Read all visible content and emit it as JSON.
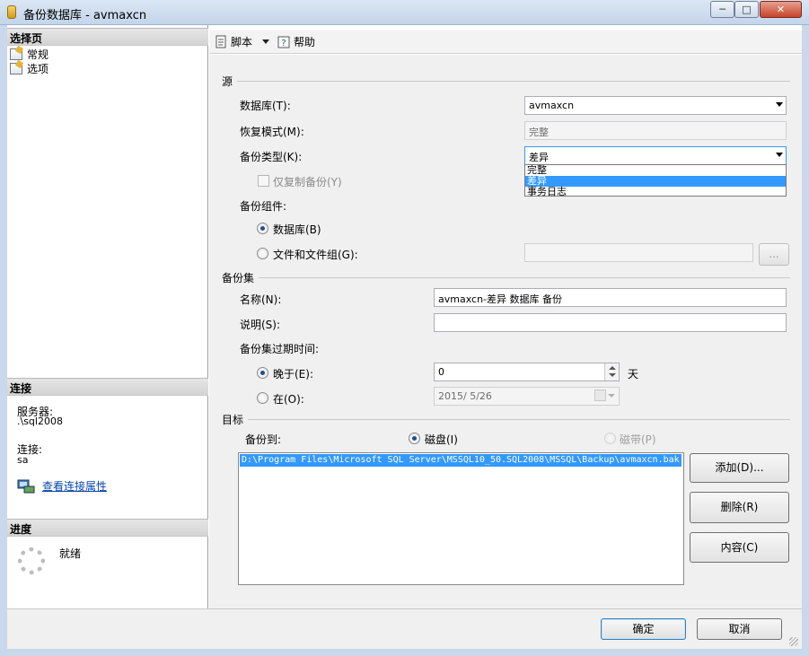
{
  "window": {
    "title": "备份数据库 - avmaxcn",
    "controls": {
      "minimize": "─",
      "maximize": "□",
      "close": "✕"
    }
  },
  "left_panel": {
    "select_page_header": "选择页",
    "pages": [
      {
        "label": "常规",
        "icon": "page-icon"
      },
      {
        "label": "选项",
        "icon": "page-icon"
      }
    ],
    "connection_header": "连接",
    "server_label": "服务器:",
    "server_value": ".\\sql2008",
    "connection_label": "连接:",
    "connection_value": "sa",
    "view_props_link": "查看连接属性",
    "progress_header": "进度",
    "progress_status": "就绪"
  },
  "toolbar": {
    "script_label": "脚本",
    "help_label": "帮助"
  },
  "source": {
    "group_label": "源",
    "database_label": "数据库(T):",
    "database_value": "avmaxcn",
    "recovery_label": "恢复模式(M):",
    "recovery_value": "完整",
    "backup_type_label": "备份类型(K):",
    "backup_type_value": "差异",
    "backup_type_options": [
      "完整",
      "差异",
      "事务日志"
    ],
    "selected_option": "差异",
    "copy_only_label": "仅复制备份(Y)",
    "component_label": "备份组件:",
    "component_database_label": "数据库(B)",
    "component_files_label": "文件和文件组(G):",
    "browse_label": "..."
  },
  "backup_set": {
    "group_label": "备份集",
    "name_label": "名称(N):",
    "name_value": "avmaxcn-差异 数据库 备份",
    "desc_label": "说明(S):",
    "desc_value": "",
    "expire_label": "备份集过期时间:",
    "after_label": "晚于(E):",
    "after_value": "0",
    "days_unit": "天",
    "on_label": "在(O):",
    "on_value": "2015/ 5/26"
  },
  "destination": {
    "group_label": "目标",
    "backup_to_label": "备份到:",
    "disk_label": "磁盘(I)",
    "tape_label": "磁带(P)",
    "paths": [
      "D:\\Program Files\\Microsoft SQL Server\\MSSQL10_50.SQL2008\\MSSQL\\Backup\\avmaxcn.bak"
    ],
    "add_label": "添加(D)...",
    "remove_label": "删除(R)",
    "contents_label": "内容(C)"
  },
  "footer": {
    "ok_label": "确定",
    "cancel_label": "取消"
  },
  "colors": {
    "selection": "#3399ff",
    "link": "#0645ad"
  }
}
